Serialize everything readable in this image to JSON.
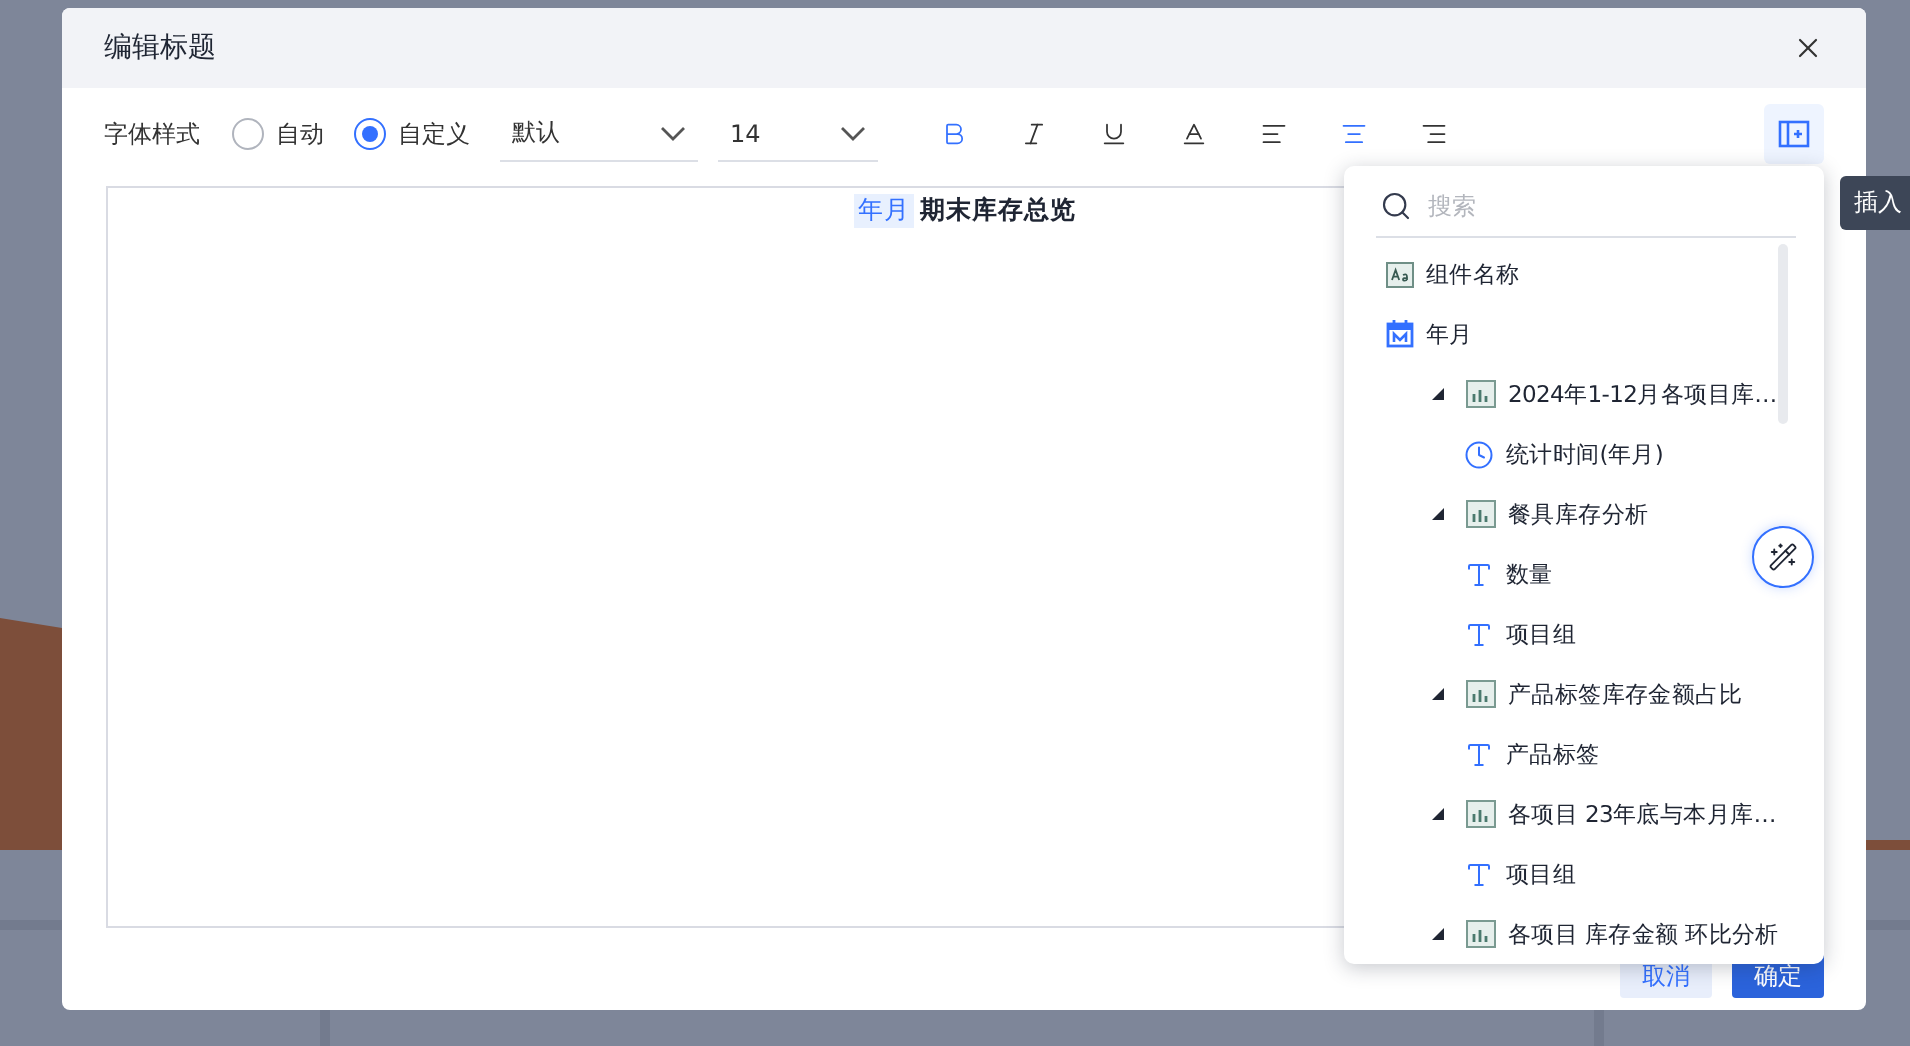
{
  "dialog": {
    "title": "编辑标题"
  },
  "toolbar": {
    "label": "字体样式",
    "radios": [
      {
        "label": "自动",
        "selected": false
      },
      {
        "label": "自定义",
        "selected": true
      }
    ],
    "selects": [
      {
        "value": "默认"
      },
      {
        "value": "14"
      }
    ],
    "format_buttons": [
      {
        "kind": "bold",
        "selected": true
      },
      {
        "kind": "italic",
        "selected": false
      },
      {
        "kind": "underline",
        "selected": false
      },
      {
        "kind": "color",
        "selected": false
      }
    ],
    "align_buttons": [
      {
        "kind": "left",
        "selected": false
      },
      {
        "kind": "center",
        "selected": true
      },
      {
        "kind": "right",
        "selected": false
      }
    ],
    "insert_button": {
      "selected": true
    }
  },
  "editor": {
    "tag": "年月",
    "text": "期末库存总览"
  },
  "tooltip": "插入",
  "field_menu": {
    "search": {
      "placeholder": "搜索"
    },
    "items": [
      {
        "kind": "text",
        "label": "组件名称"
      },
      {
        "kind": "date",
        "label": "年月"
      },
      {
        "kind": "chart",
        "label": "2024年1-12月各项目库…",
        "expanded": true,
        "children": [
          {
            "kind": "time",
            "label": "统计时间(年月)"
          }
        ]
      },
      {
        "kind": "chart",
        "label": "餐具库存分析",
        "expanded": true,
        "children": [
          {
            "kind": "field",
            "label": "数量"
          },
          {
            "kind": "field",
            "label": "项目组"
          }
        ]
      },
      {
        "kind": "chart",
        "label": "产品标签库存金额占比",
        "expanded": true,
        "children": [
          {
            "kind": "field",
            "label": "产品标签"
          }
        ]
      },
      {
        "kind": "chart",
        "label": "各项目 23年底与本月库…",
        "expanded": true,
        "children": [
          {
            "kind": "field",
            "label": "项目组"
          }
        ]
      },
      {
        "kind": "chart",
        "label": "各项目 库存金额 环比分析",
        "expanded": true
      }
    ]
  },
  "footer": {
    "buttons": [
      {
        "label": "取消",
        "kind": "secondary"
      },
      {
        "label": "确定",
        "kind": "primary"
      }
    ]
  }
}
